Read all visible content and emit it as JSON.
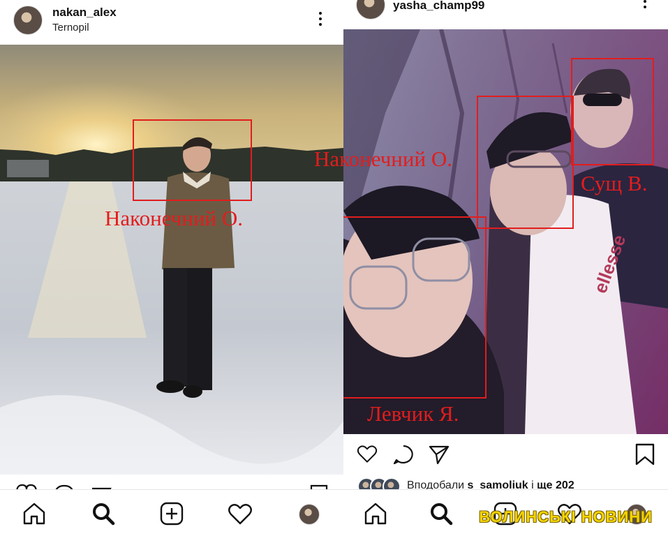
{
  "left_post": {
    "username": "nakan_alex",
    "location": "Ternopil",
    "tag": "Наконечний О."
  },
  "right_post": {
    "username": "yasha_champ99",
    "tags": [
      "Наконечний О.",
      "Сущ В.",
      "Левчик Я."
    ],
    "liked_prefix": "Вподобали",
    "liked_user": "s_samoliuk",
    "liked_joiner": "і",
    "liked_count": "ще 202"
  },
  "nav_icons": [
    "home-icon",
    "search-icon",
    "add-post-icon",
    "heart-icon",
    "profile-avatar"
  ],
  "action_icons": [
    "heart-icon",
    "comment-icon",
    "share-icon",
    "bookmark-icon"
  ],
  "watermark": "ВОЛИНСЬКІ НОВИНИ",
  "colors": {
    "tag_red": "#e21d1d",
    "watermark_yellow": "#f5d400"
  }
}
